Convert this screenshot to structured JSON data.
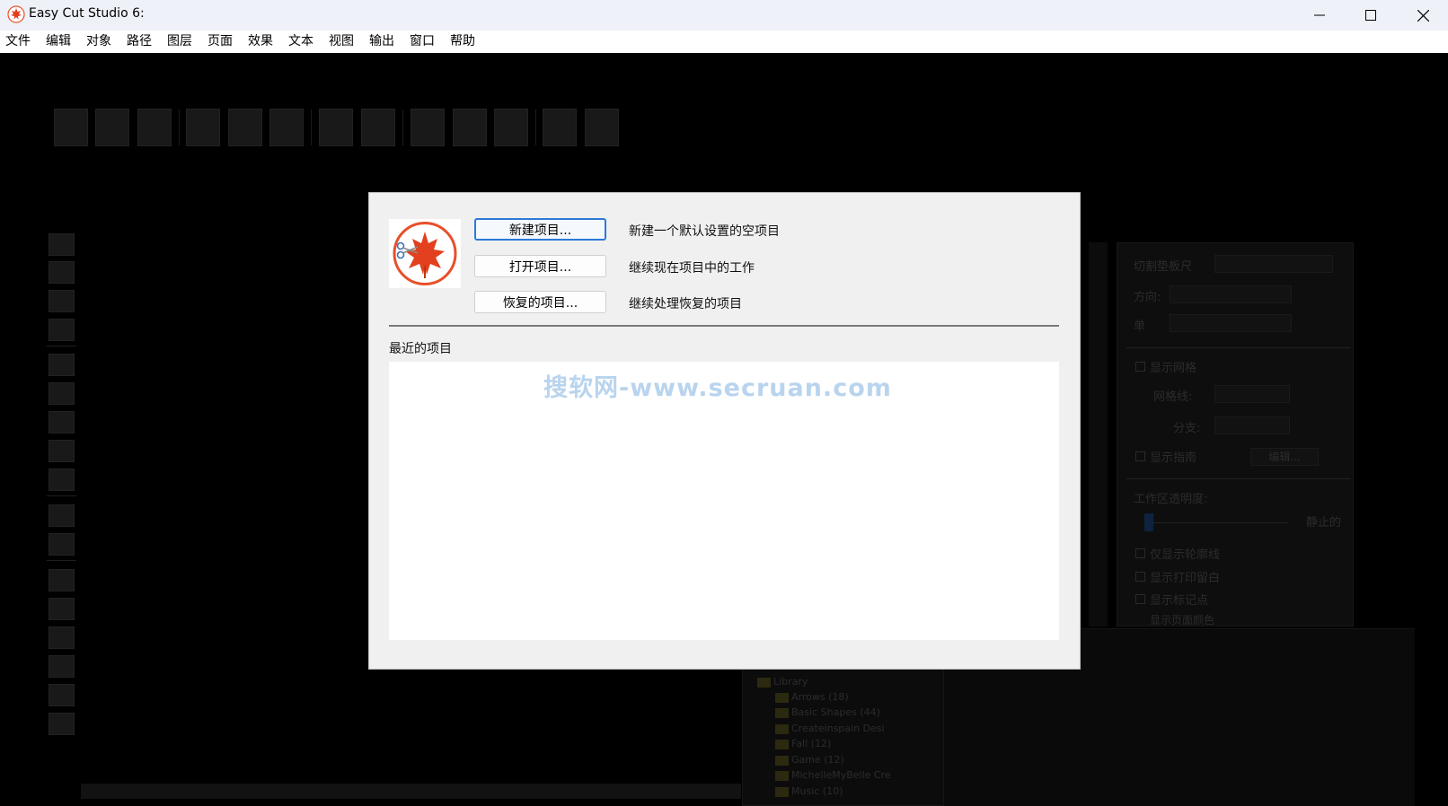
{
  "window": {
    "title": "Easy Cut Studio 6:",
    "icons": {
      "app": "maple-leaf-logo",
      "minimize": "minimize-icon",
      "maximize": "maximize-icon",
      "close": "close-icon"
    }
  },
  "menu": [
    "文件",
    "编辑",
    "对象",
    "路径",
    "图层",
    "页面",
    "效果",
    "文本",
    "视图",
    "输出",
    "窗口",
    "帮助"
  ],
  "dialog": {
    "buttons": [
      {
        "label": "新建项目...",
        "description": "新建一个默认设置的空项目"
      },
      {
        "label": "打开项目...",
        "description": "继续现在项目中的工作"
      },
      {
        "label": "恢复的项目...",
        "description": "继续处理恢复的项目"
      }
    ],
    "recent_label": "最近的项目",
    "recent_items": [],
    "logo_icon": "maple-leaf-scissors-logo"
  },
  "watermark": "搜软网-www.secruan.com",
  "background_panel": {
    "cutting_mat_label": "切割垫板尺",
    "direction_label": "方向:",
    "unit_label": "单",
    "show_grid_label": "显示网格",
    "grid_lines_label": "网格线:",
    "subdivisions_label": "分支:",
    "show_guides_label": "显示指南",
    "edit_button": "编辑...",
    "workspace_transparency_label": "工作区透明度:",
    "still_label": "静止的",
    "show_outline_only": "仅显示轮廓线",
    "show_print_margin": "显示打印留白",
    "show_marks": "显示标记点",
    "show_page_color": "显示页面颜色"
  },
  "library": {
    "root": "Library",
    "items": [
      "Arrows (18)",
      "Basic Shapes (44)",
      "Createinspain Desi",
      "Fall (12)",
      "Game (12)",
      "MichelleMyBelle Cre",
      "Music (10)"
    ]
  },
  "colors": {
    "dialog_bg": "#f0f0f0",
    "primary_border": "#2b7ad8",
    "titlebar_bg": "#eef1f8",
    "watermark": "#b9d4ee"
  }
}
